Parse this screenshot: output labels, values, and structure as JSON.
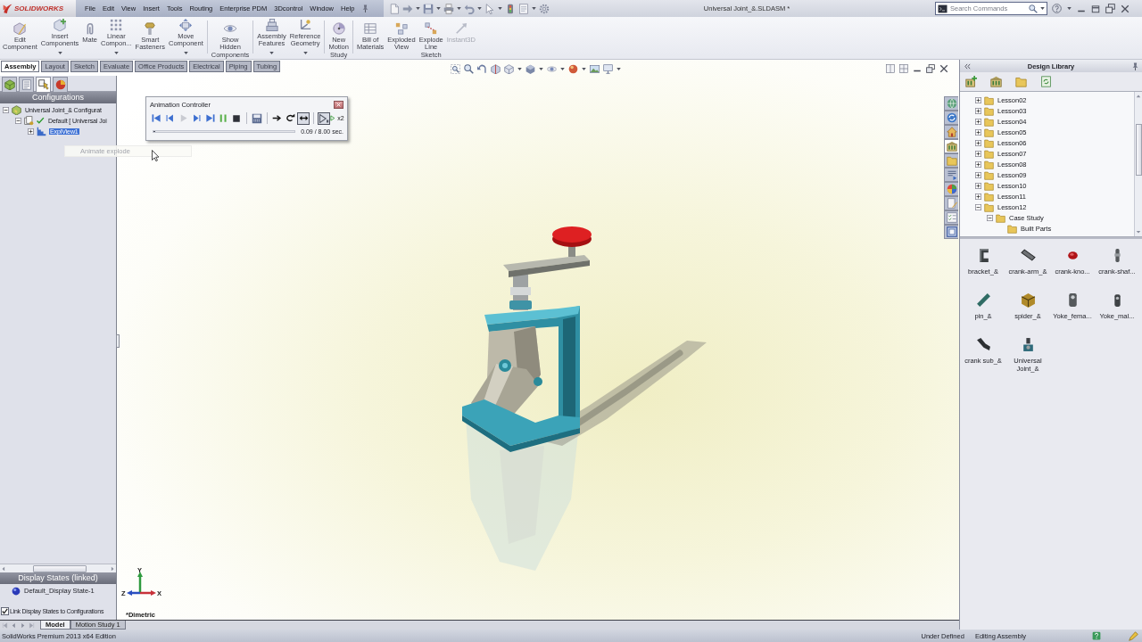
{
  "title_bar": {
    "logo": "SOLIDWORKS",
    "menu": [
      "File",
      "Edit",
      "View",
      "Insert",
      "Tools",
      "Routing",
      "Enterprise PDM",
      "3Dcontrol",
      "Window",
      "Help"
    ],
    "document_title": "Universal Joint_&.SLDASM *",
    "search": {
      "placeholder": "Search Commands"
    }
  },
  "command_manager": {
    "groups": [
      [
        {
          "label": "Edit\nComponent",
          "has_menu": false,
          "disabled": false
        },
        {
          "label": "Insert\nComponents",
          "has_menu": true,
          "disabled": false
        },
        {
          "label": "Mate",
          "has_menu": false,
          "disabled": false
        },
        {
          "label": "Linear\nCompon...",
          "has_menu": true,
          "disabled": false
        },
        {
          "label": "Smart\nFasteners",
          "has_menu": false,
          "disabled": false
        },
        {
          "label": "Move\nComponent",
          "has_menu": true,
          "disabled": false
        }
      ],
      [
        {
          "label": "Show\nHidden\nComponents",
          "has_menu": false,
          "disabled": false
        }
      ],
      [
        {
          "label": "Assembly\nFeatures",
          "has_menu": true,
          "disabled": false
        },
        {
          "label": "Reference\nGeometry",
          "has_menu": true,
          "disabled": false
        }
      ],
      [
        {
          "label": "New\nMotion\nStudy",
          "has_menu": false,
          "disabled": false
        }
      ],
      [
        {
          "label": "Bill of\nMaterials",
          "has_menu": false,
          "disabled": false
        },
        {
          "label": "Exploded\nView",
          "has_menu": false,
          "disabled": false
        },
        {
          "label": "Explode\nLine\nSketch",
          "has_menu": false,
          "disabled": false
        },
        {
          "label": "Instant3D",
          "has_menu": false,
          "disabled": true
        }
      ]
    ],
    "tabs": [
      {
        "label": "Assembly",
        "selected": true
      },
      {
        "label": "Layout",
        "selected": false
      },
      {
        "label": "Sketch",
        "selected": false
      },
      {
        "label": "Evaluate",
        "selected": false
      },
      {
        "label": "Office Products",
        "selected": false
      },
      {
        "label": "Electrical",
        "selected": false
      },
      {
        "label": "Piping",
        "selected": false
      },
      {
        "label": "Tubing",
        "selected": false
      }
    ]
  },
  "feature_manager": {
    "tabs": [
      {
        "selected": false
      },
      {
        "selected": false
      },
      {
        "selected": true
      },
      {
        "selected": false
      }
    ],
    "header": "Configurations",
    "tree": [
      {
        "kind": "assembly",
        "label": "Universal Joint_& Configurat",
        "expanded": true,
        "active": false,
        "selected": false,
        "children": [
          {
            "kind": "configuration",
            "label": "Default [ Universal Joi",
            "expanded": true,
            "active": true,
            "selected": false,
            "children": [
              {
                "kind": "exploded_view",
                "label": "ExplView1",
                "expanded": false,
                "active": false,
                "selected": true
              }
            ]
          }
        ]
      }
    ],
    "tooltip": "Animate explode",
    "display_states": {
      "header": "Display States (linked)",
      "items": [
        "Default_Display State-1"
      ],
      "link": {
        "label": "Link Display States to Configurations",
        "checked": true
      }
    }
  },
  "animation_controller": {
    "title": "Animation Controller",
    "transport": [
      {
        "kind": "start",
        "disabled": false
      },
      {
        "kind": "step_back",
        "disabled": false
      },
      {
        "kind": "play",
        "disabled": true
      },
      {
        "kind": "step_forward",
        "disabled": false
      },
      {
        "kind": "end",
        "disabled": false
      },
      {
        "kind": "pause",
        "disabled": false
      },
      {
        "kind": "stop",
        "disabled": false
      },
      {
        "kind": "save",
        "disabled": false
      }
    ],
    "modes": [
      {
        "kind": "normal",
        "selected": false
      },
      {
        "kind": "loop",
        "selected": false
      },
      {
        "kind": "reciprocate",
        "selected": true
      }
    ],
    "speeds": [
      {
        "kind": "slow",
        "selected": true
      },
      {
        "kind": "fast",
        "label": "x2",
        "selected": false
      }
    ],
    "progress": {
      "level": 0.011,
      "reading": "0.09 / 8.00 sec."
    }
  },
  "viewport": {
    "triad": [
      {
        "label": "Y",
        "color": "#2e9a3e"
      },
      {
        "label": "Z",
        "color": "#2a4fc0"
      },
      {
        "label": "X",
        "color": "#c8323a"
      }
    ],
    "orientation": "*Dimetric"
  },
  "task_pane": {
    "tabs": [
      {
        "selected": false
      },
      {
        "selected": false
      },
      {
        "selected": false
      },
      {
        "selected": true
      },
      {
        "selected": false
      },
      {
        "selected": false
      },
      {
        "selected": false
      },
      {
        "selected": false
      },
      {
        "selected": false
      },
      {
        "selected": false
      }
    ],
    "title": "Design Library",
    "tree": [
      {
        "label": "Lesson02",
        "expanded": false,
        "selected": false
      },
      {
        "label": "Lesson03",
        "expanded": false,
        "selected": false
      },
      {
        "label": "Lesson04",
        "expanded": false,
        "selected": false
      },
      {
        "label": "Lesson05",
        "expanded": false,
        "selected": false
      },
      {
        "label": "Lesson06",
        "expanded": false,
        "selected": false
      },
      {
        "label": "Lesson07",
        "expanded": false,
        "selected": false
      },
      {
        "label": "Lesson08",
        "expanded": false,
        "selected": false
      },
      {
        "label": "Lesson09",
        "expanded": false,
        "selected": false
      },
      {
        "label": "Lesson10",
        "expanded": false,
        "selected": false
      },
      {
        "label": "Lesson11",
        "expanded": false,
        "selected": false
      },
      {
        "label": "Lesson12",
        "expanded": true,
        "selected": false,
        "children": [
          {
            "label": "Case Study",
            "expanded": true,
            "selected": false,
            "children": [
              {
                "label": "Built Parts",
                "selected": false
              }
            ]
          }
        ]
      }
    ],
    "items": [
      "bracket_&",
      "crank-arm_&",
      "crank-kno...",
      "crank-shaf...",
      "pin_&",
      "spider_&",
      "Yoke_fema...",
      "Yoke_mal...",
      "crank sub_&",
      "Universal\nJoint_&"
    ]
  },
  "bottom_tabs": [
    {
      "label": "Model",
      "selected": true
    },
    {
      "label": "Motion Study 1",
      "selected": false
    }
  ],
  "status_bar": {
    "edition": "SolidWorks Premium 2013 x64 Edition",
    "fields": [
      "Under Defined",
      "Editing Assembly"
    ]
  }
}
